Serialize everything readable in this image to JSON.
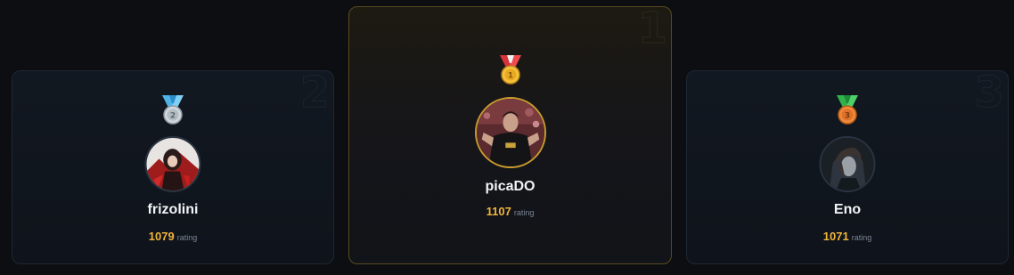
{
  "leaderboard": {
    "podium": [
      {
        "rank_label": "2",
        "medal": "silver-medal-icon",
        "medal_number": "2",
        "name": "frizolini",
        "rating_value": "1079",
        "rating_unit": "rating"
      },
      {
        "rank_label": "1",
        "medal": "gold-medal-icon",
        "medal_number": "1",
        "name": "picaDO",
        "rating_value": "1107",
        "rating_unit": "rating"
      },
      {
        "rank_label": "3",
        "medal": "bronze-medal-icon",
        "medal_number": "3",
        "name": "Eno",
        "rating_value": "1071",
        "rating_unit": "rating"
      }
    ]
  },
  "colors": {
    "background": "#0c0e12",
    "card": "#121821",
    "gold_border": "#c99b2e",
    "rating_accent": "#f0b43a",
    "muted_text": "#7c8594"
  }
}
